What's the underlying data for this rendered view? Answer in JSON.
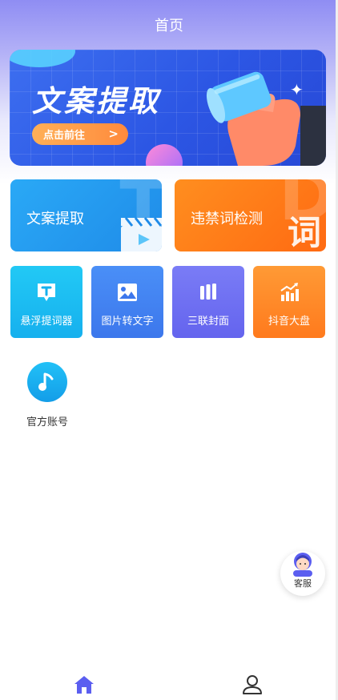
{
  "header": {
    "title": "首页"
  },
  "banner": {
    "title": "文案提取",
    "button_label": "点击前往",
    "button_chevron": ">"
  },
  "features": [
    {
      "label": "文案提取",
      "icon": "clapperboard-icon"
    },
    {
      "label": "违禁词检测",
      "corner_char": "词"
    }
  ],
  "tools": [
    {
      "label": "悬浮提词器",
      "icon": "text-bubble-icon"
    },
    {
      "label": "图片转文字",
      "icon": "image-icon"
    },
    {
      "label": "三联封面",
      "icon": "three-bars-icon"
    },
    {
      "label": "抖音大盘",
      "icon": "bar-chart-trend-icon"
    }
  ],
  "official": {
    "label": "官方账号",
    "icon": "music-note-icon"
  },
  "service": {
    "label": "客服",
    "icon": "support-agent-icon"
  },
  "tabbar": [
    {
      "icon": "home-icon",
      "active": true,
      "color": "#5b5ef0"
    },
    {
      "icon": "user-icon",
      "active": false,
      "color": "#333333"
    }
  ]
}
